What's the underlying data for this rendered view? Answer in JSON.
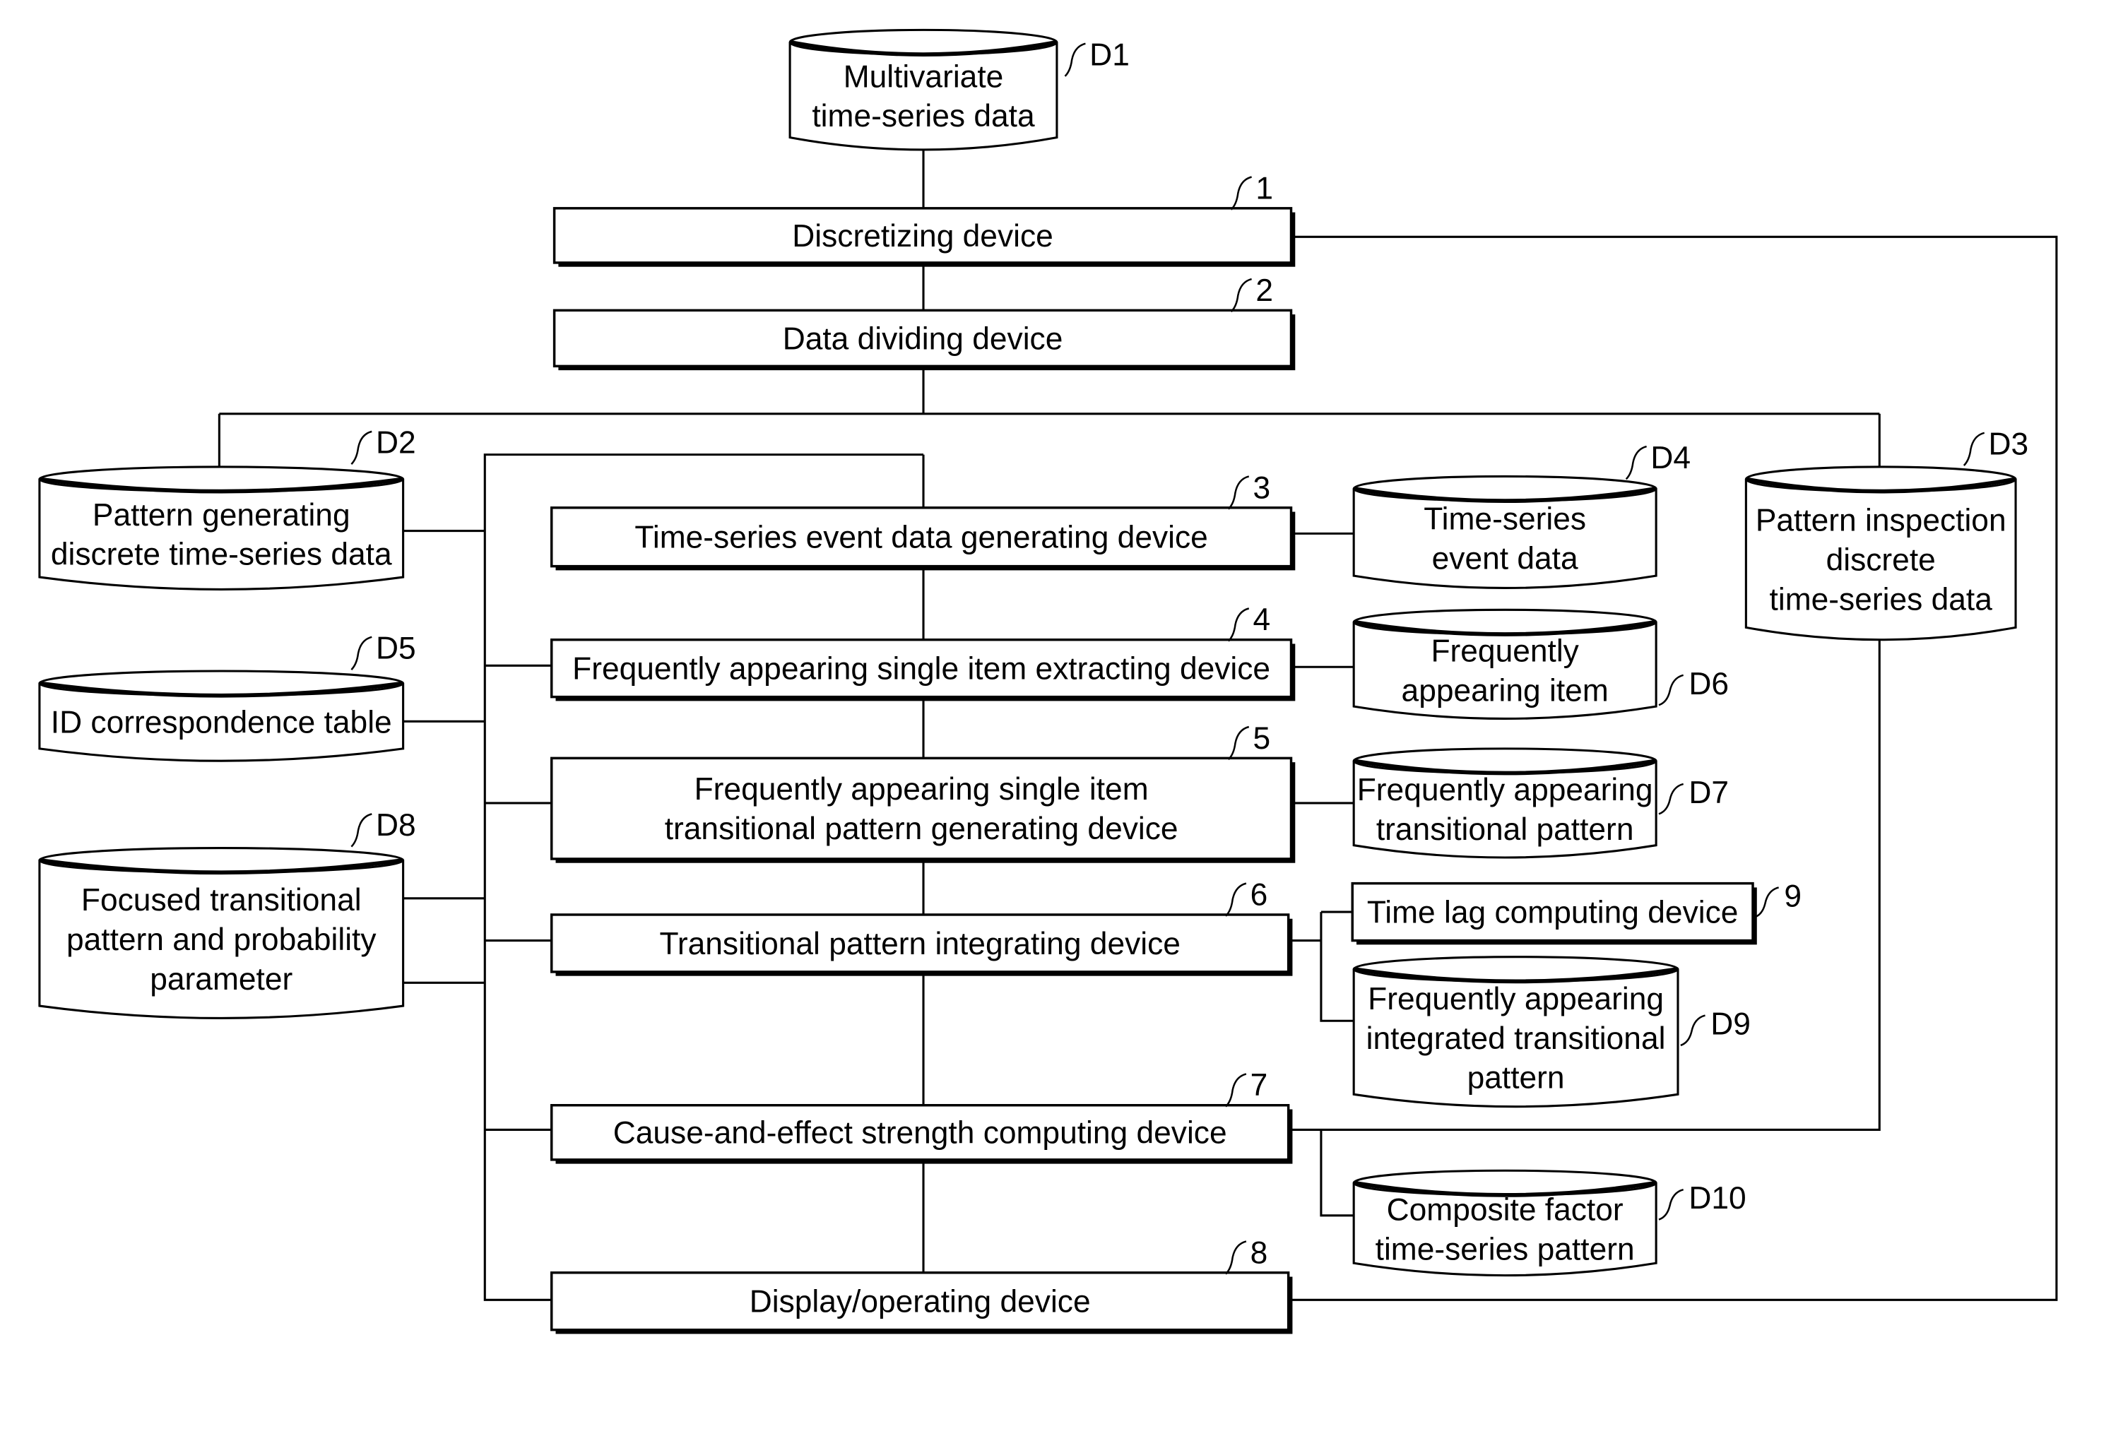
{
  "figure": {
    "devices": [
      {
        "id": "1",
        "lines": [
          "Discretizing device"
        ]
      },
      {
        "id": "2",
        "lines": [
          "Data dividing device"
        ]
      },
      {
        "id": "3",
        "lines": [
          "Time-series event data generating device"
        ]
      },
      {
        "id": "4",
        "lines": [
          "Frequently appearing single item extracting device"
        ]
      },
      {
        "id": "5",
        "lines": [
          "Frequently appearing single item",
          "transitional pattern generating device"
        ]
      },
      {
        "id": "6",
        "lines": [
          "Transitional pattern integrating device"
        ]
      },
      {
        "id": "7",
        "lines": [
          "Cause-and-effect strength computing device"
        ]
      },
      {
        "id": "8",
        "lines": [
          "Display/operating device"
        ]
      },
      {
        "id": "9",
        "lines": [
          "Time lag computing device"
        ]
      }
    ],
    "databases": [
      {
        "id": "D1",
        "lines": [
          "Multivariate",
          "time-series data"
        ]
      },
      {
        "id": "D2",
        "lines": [
          "Pattern generating",
          "discrete time-series data"
        ]
      },
      {
        "id": "D3",
        "lines": [
          "Pattern inspection",
          "discrete",
          "time-series data"
        ]
      },
      {
        "id": "D4",
        "lines": [
          "Time-series",
          "event data"
        ]
      },
      {
        "id": "D5",
        "lines": [
          "ID correspondence table"
        ]
      },
      {
        "id": "D6",
        "lines": [
          "Frequently",
          "appearing item"
        ]
      },
      {
        "id": "D7",
        "lines": [
          "Frequently appearing",
          "transitional pattern"
        ]
      },
      {
        "id": "D8",
        "lines": [
          "Focused transitional",
          "pattern and probability",
          "parameter"
        ]
      },
      {
        "id": "D9",
        "lines": [
          "Frequently appearing",
          "integrated transitional",
          "pattern"
        ]
      },
      {
        "id": "D10",
        "lines": [
          "Composite factor",
          "time-series pattern"
        ]
      }
    ]
  }
}
